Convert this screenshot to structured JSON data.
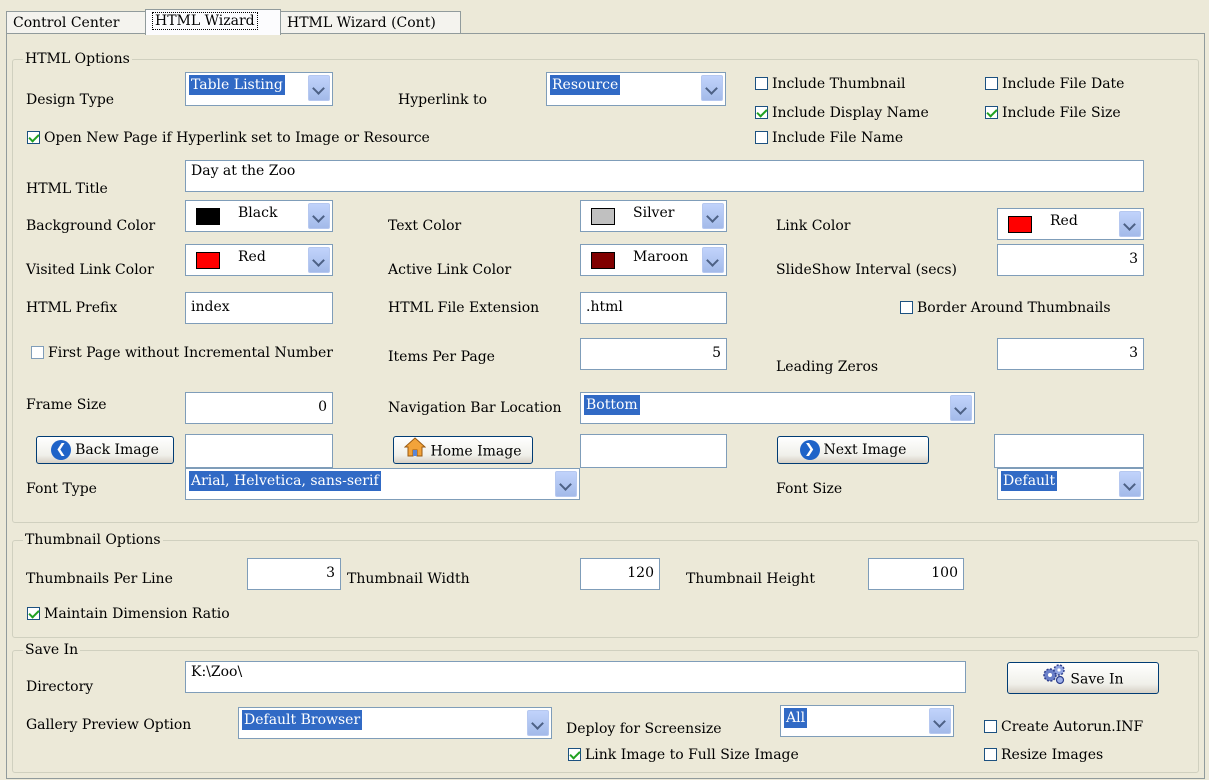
{
  "tabs": [
    "Control Center",
    "HTML Wizard",
    "HTML Wizard (Cont)"
  ],
  "html_options": {
    "legend": "HTML Options",
    "design_type_label": "Design Type",
    "design_type_value": "Table Listing",
    "hyperlink_label": "Hyperlink to",
    "hyperlink_value": "Resource",
    "include_thumbnail": "Include Thumbnail",
    "include_file_date": "Include File Date",
    "include_display_name": "Include Display Name",
    "include_file_size": "Include File Size",
    "include_file_name": "Include File Name",
    "open_new_page": "Open New Page if Hyperlink set to Image or Resource",
    "html_title_label": "HTML Title",
    "html_title_value": "Day at the Zoo",
    "bg_color_label": "Background Color",
    "bg_color_value": "Black",
    "bg_color_hex": "#000000",
    "text_color_label": "Text Color",
    "text_color_value": "Silver",
    "text_color_hex": "#C0C0C0",
    "link_color_label": "Link Color",
    "link_color_value": "Red",
    "link_color_hex": "#FF0000",
    "visited_label": "Visited Link Color",
    "visited_value": "Red",
    "visited_hex": "#FF0000",
    "active_label": "Active Link Color",
    "active_value": "Maroon",
    "active_hex": "#800000",
    "slideshow_label": "SlideShow Interval (secs)",
    "slideshow_value": "3",
    "prefix_label": "HTML Prefix",
    "prefix_value": "index",
    "ext_label": "HTML File Extension",
    "ext_value": ".html",
    "border_thumbs": "Border Around Thumbnails",
    "first_page": "First Page without Incremental Number",
    "items_label": "Items Per Page",
    "items_value": "5",
    "leading_label": "Leading Zeros",
    "leading_value": "3",
    "frame_label": "Frame Size",
    "frame_value": "0",
    "navbar_label": "Navigation Bar Location",
    "navbar_value": "Bottom",
    "back_btn": "Back Image",
    "home_btn": "Home Image",
    "next_btn": "Next Image",
    "font_type_label": "Font Type",
    "font_type_value": "Arial, Helvetica, sans-serif",
    "font_size_label": "Font Size",
    "font_size_value": "Default"
  },
  "thumb_options": {
    "legend": "Thumbnail Options",
    "per_line_label": "Thumbnails Per Line",
    "per_line_value": "3",
    "width_label": "Thumbnail Width",
    "width_value": "120",
    "height_label": "Thumbnail Height",
    "height_value": "100",
    "maintain": "Maintain Dimension Ratio"
  },
  "save_in": {
    "legend": "Save In",
    "dir_label": "Directory",
    "dir_value": "K:\\Zoo\\",
    "save_btn": "Save In",
    "preview_label": "Gallery Preview Option",
    "preview_value": "Default Browser",
    "deploy_label": "Deploy for Screensize",
    "deploy_value": "All",
    "autorun": "Create Autorun.INF",
    "link_full": "Link Image to Full Size Image",
    "resize": "Resize Images"
  },
  "checked": {
    "include_thumbnail": false,
    "include_file_date": false,
    "include_display_name": true,
    "include_file_size": true,
    "include_file_name": false,
    "open_new_page": true,
    "border_thumbs": false,
    "first_page": false,
    "maintain": true,
    "autorun": false,
    "link_full": true,
    "resize": false
  },
  "icons": {
    "back": "back-arrow-icon",
    "home": "home-icon",
    "next": "next-arrow-icon",
    "save": "gears-icon"
  }
}
